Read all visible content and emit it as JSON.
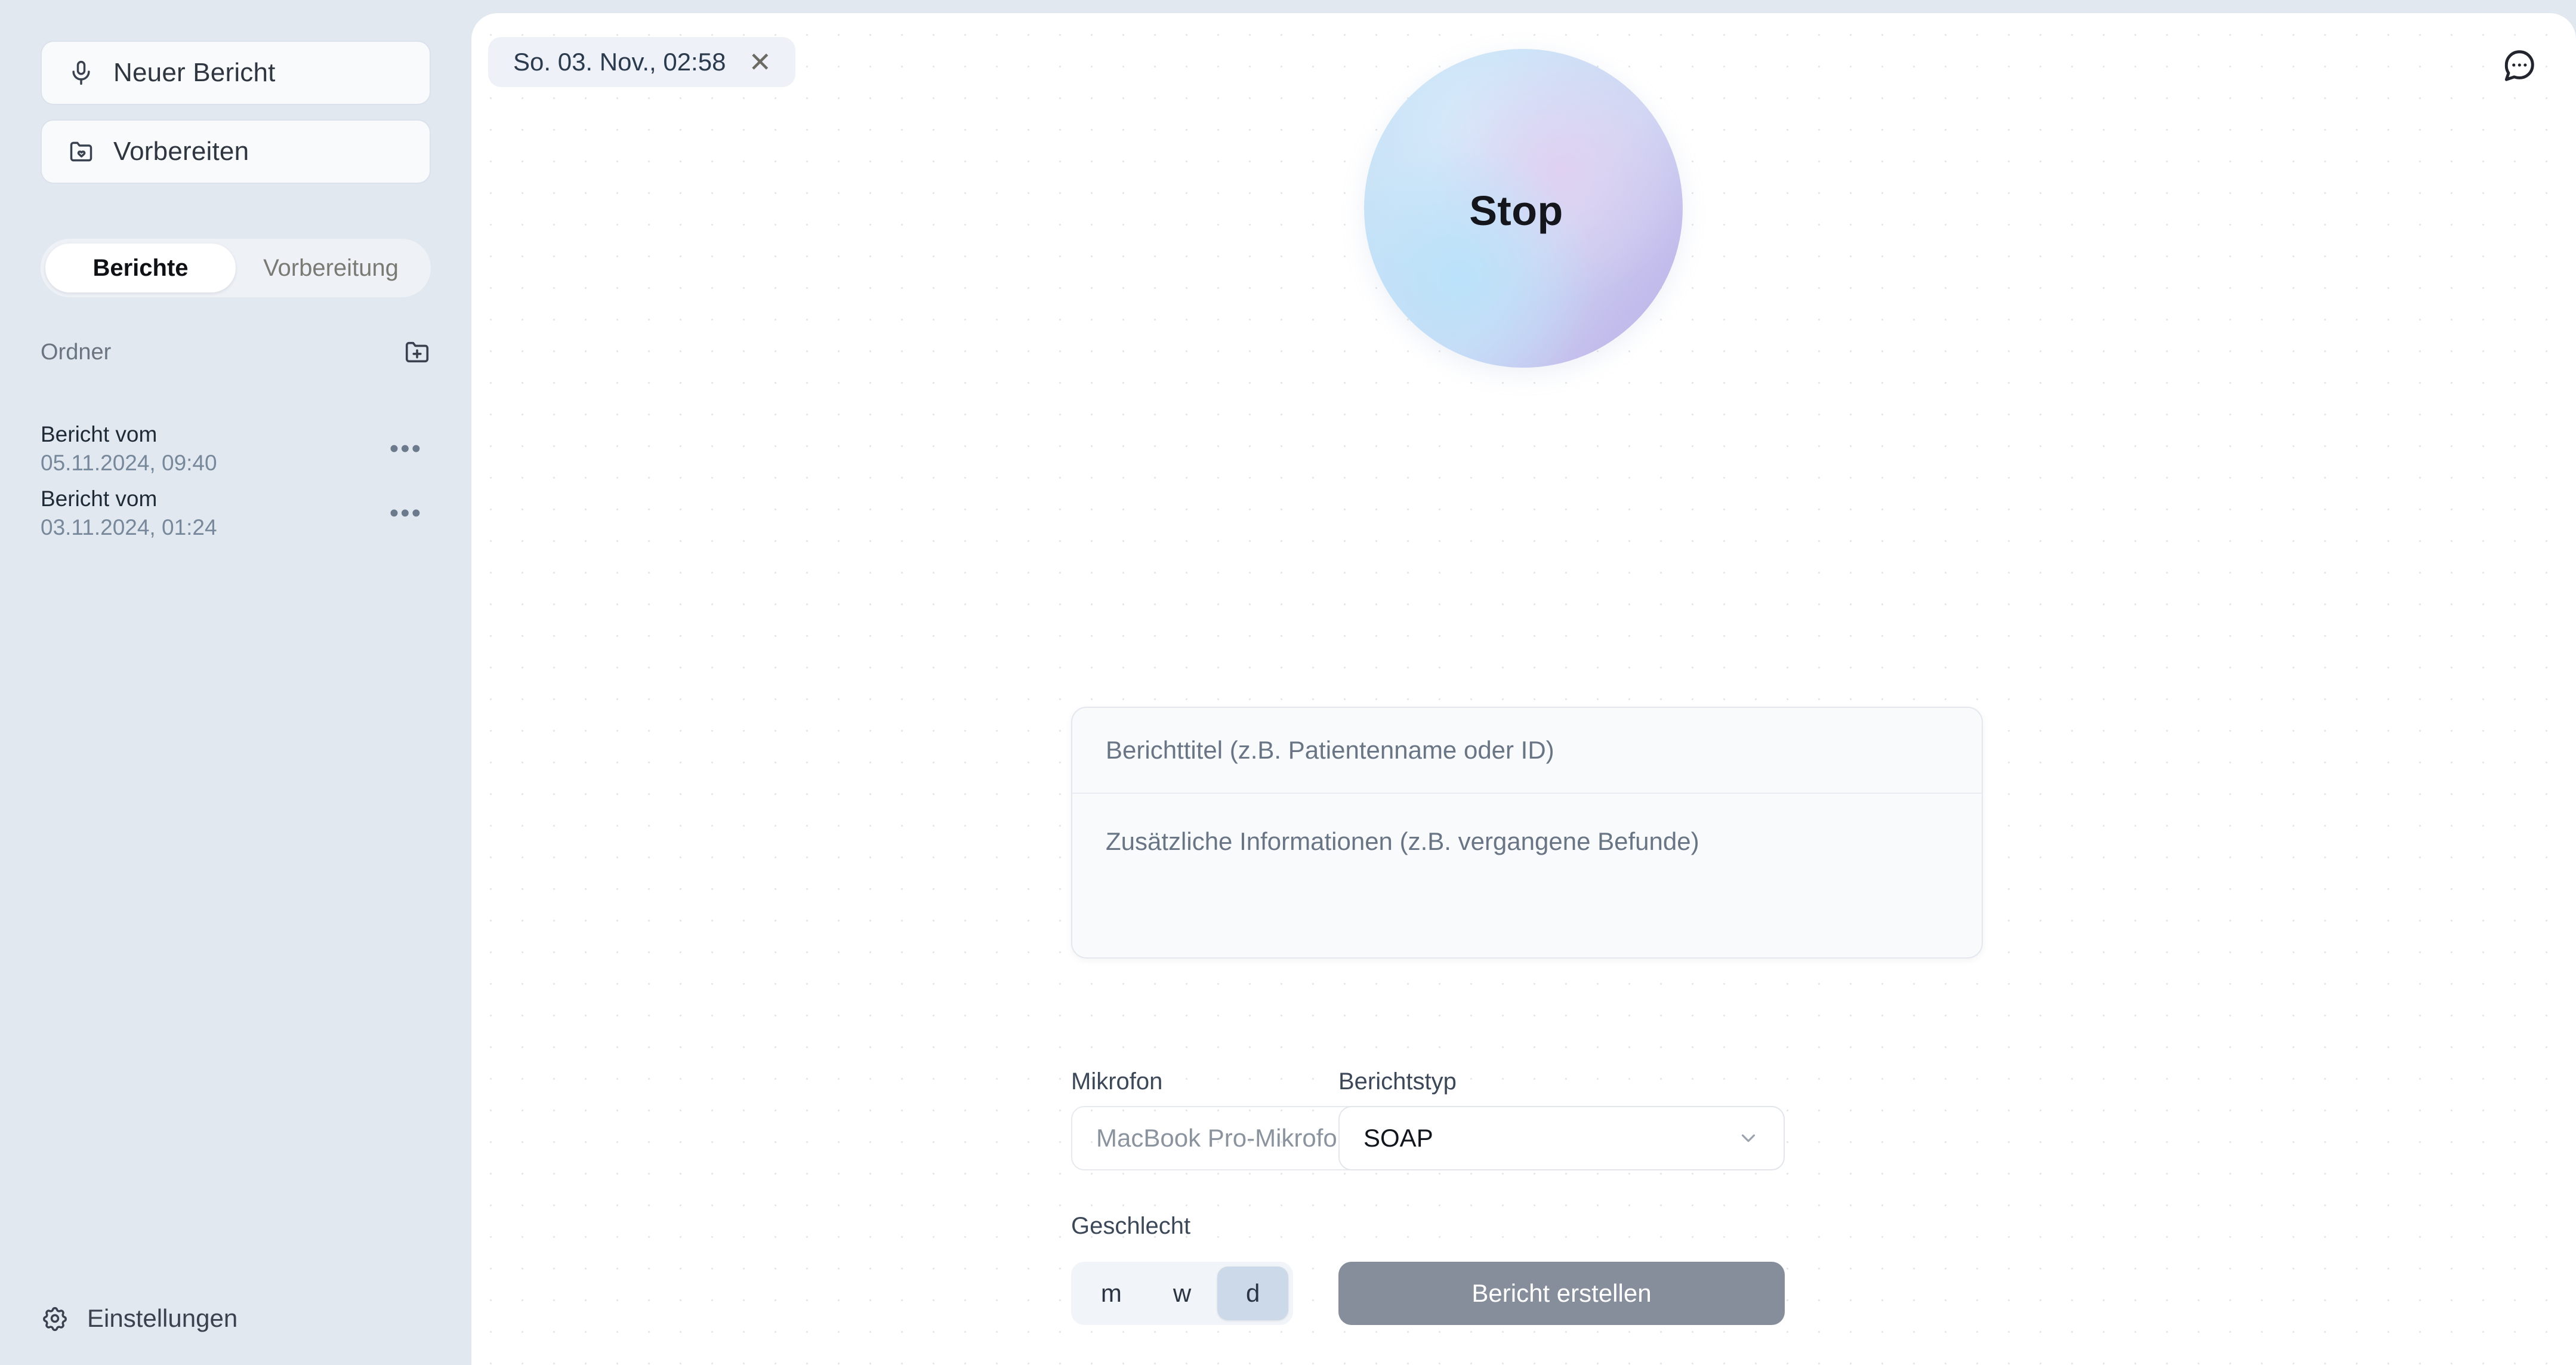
{
  "sidebar": {
    "new_report_button": {
      "label": "Neuer Bericht",
      "icon": "microphone-icon"
    },
    "prepare_button": {
      "label": "Vorbereiten",
      "icon": "folder-heart-icon"
    },
    "tabs": [
      {
        "label": "Berichte",
        "active": true
      },
      {
        "label": "Vorbereitung",
        "active": false
      }
    ],
    "folders_section": {
      "label": "Ordner",
      "add_icon": "folder-plus-icon"
    },
    "reports": [
      {
        "title": "Bericht vom",
        "date": "05.11.2024, 09:40",
        "menu": "•••"
      },
      {
        "title": "Bericht vom",
        "date": "03.11.2024, 01:24",
        "menu": "•••"
      }
    ],
    "settings": {
      "label": "Einstellungen",
      "icon": "gear-icon"
    }
  },
  "main": {
    "doc_tab": {
      "label": "So. 03. Nov., 02:58",
      "close": "✕"
    },
    "chat_button": {
      "icon": "chat-bubble-dots-icon"
    },
    "record_orb": {
      "label": "Stop"
    },
    "form": {
      "title_placeholder": "Berichttitel (z.B. Patientenname oder ID)",
      "title_value": "",
      "notes_placeholder": "Zusätzliche Informationen (z.B. vergangene Befunde)",
      "notes_value": ""
    },
    "microphone": {
      "label": "Mikrofon",
      "selected": "MacBook Pro-Mikrofon",
      "chevron": "chevron-down-icon"
    },
    "report_type": {
      "label": "Berichtstyp",
      "selected": "SOAP",
      "chevron": "chevron-down-icon"
    },
    "gender": {
      "label": "Geschlecht",
      "options": [
        {
          "label": "m",
          "active": false
        },
        {
          "label": "w",
          "active": false
        },
        {
          "label": "d",
          "active": true
        }
      ]
    },
    "submit_button": {
      "label": "Bericht erstellen",
      "enabled": false
    }
  },
  "colors": {
    "sidebar_bg": "#e2e8f0",
    "panel_bg": "#ffffff",
    "orb_blue": "#bfe0f5",
    "orb_violet": "#b9b3e6",
    "submit_disabled": "#868e9b",
    "segment_active": "#ccd9e8",
    "text_dark": "#1f2a37",
    "text_muted": "#78889b"
  }
}
